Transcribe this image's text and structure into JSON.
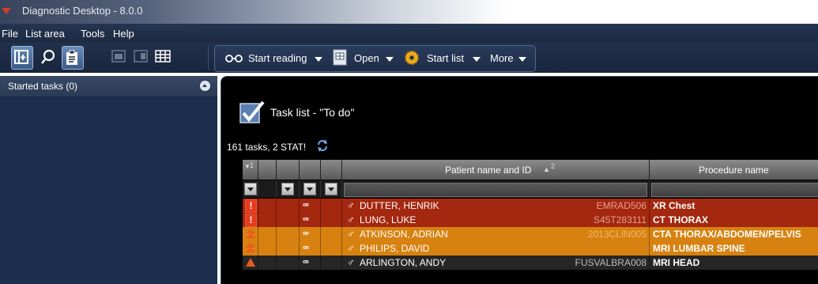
{
  "window": {
    "title": "Diagnostic Desktop - 8.0.0"
  },
  "menu": [
    {
      "id": "file",
      "label": "File"
    },
    {
      "id": "listarea",
      "label": "List area"
    },
    {
      "id": "tools",
      "label": "Tools"
    },
    {
      "id": "help",
      "label": "Help"
    }
  ],
  "toolbar": {
    "start_reading": "Start reading",
    "open": "Open",
    "start_list": "Start list",
    "more": "More"
  },
  "left_panel": {
    "header": "Started tasks (0)"
  },
  "task_list": {
    "title": "Task list - \"To do\"",
    "summary": "161 tasks, 2 STAT!",
    "columns": {
      "sort_col": "1",
      "patient": "Patient name and ID",
      "patient_sort": "2",
      "procedure": "Procedure name"
    },
    "rows": [
      {
        "priority": "stat",
        "patient": "DUTTER, HENRIK",
        "id": "EMRAD506",
        "procedure": "XR Chest",
        "bg": "#a4270f",
        "id_color": "#e5a08f"
      },
      {
        "priority": "stat",
        "patient": "LUNG, LUKE",
        "id": "S45T283111",
        "procedure": "CT THORAX",
        "bg": "#a4270f",
        "id_color": "#e5a08f"
      },
      {
        "priority": "urgent",
        "patient": "ATKINSON, ADRIAN",
        "id": "2013CLIN005",
        "procedure": "CTA THORAX/ABDOMEN/PELVIS",
        "bg": "#d78210",
        "id_color": "#f2b76a"
      },
      {
        "priority": "urgent",
        "patient": "PHILIPS, DAVID",
        "id": "",
        "procedure": "MRI LUMBAR SPINE",
        "bg": "#d78210",
        "id_color": "#f2b76a"
      },
      {
        "priority": "high",
        "patient": "ARLINGTON, ANDY",
        "id": "FUSVALBRA008",
        "procedure": "MRI HEAD",
        "bg": "#262626",
        "id_color": "#bbbbbb"
      }
    ]
  },
  "colors": {
    "stat": "#a4270f",
    "urgent": "#d78210",
    "normal": "#262626",
    "accent": "#e03a1e"
  },
  "icons": {
    "reading": "glasses-icon",
    "open": "open-icon",
    "start_list": "gear-icon",
    "stat": "exclamation-icon",
    "urgent": "double-chevron-up-icon",
    "high": "triangle-up-icon",
    "patient": "male-icon"
  }
}
